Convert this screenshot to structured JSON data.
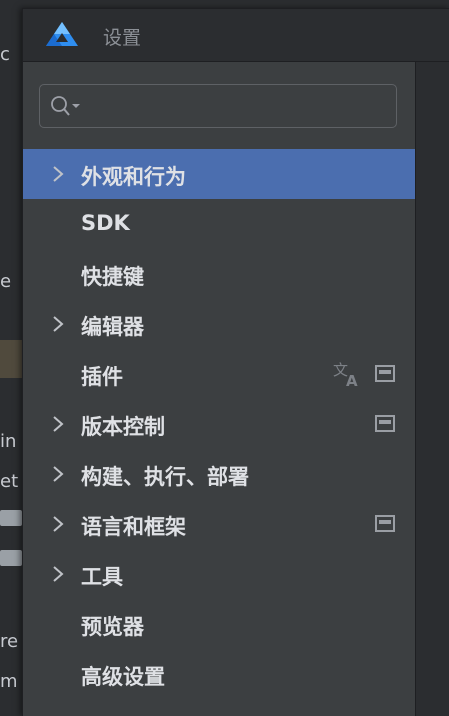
{
  "dialog": {
    "title": "设置",
    "search": {
      "placeholder": "",
      "value": ""
    }
  },
  "tree": [
    {
      "label": "外观和行为",
      "expandable": true,
      "selected": true
    },
    {
      "label": "SDK",
      "expandable": false
    },
    {
      "label": "快捷键",
      "expandable": false
    },
    {
      "label": "编辑器",
      "expandable": true
    },
    {
      "label": "插件",
      "expandable": false,
      "icons": [
        "translate-icon",
        "box-icon"
      ]
    },
    {
      "label": "版本控制",
      "expandable": true,
      "icons": [
        "box-icon"
      ]
    },
    {
      "label": "构建、执行、部署",
      "expandable": true
    },
    {
      "label": "语言和框架",
      "expandable": true,
      "icons": [
        "box-icon"
      ]
    },
    {
      "label": "工具",
      "expandable": true
    },
    {
      "label": "预览器",
      "expandable": false
    },
    {
      "label": "高级设置",
      "expandable": false
    }
  ],
  "colors": {
    "selection": "#4b6eaf",
    "panel": "#3c3f41",
    "titlebar": "#2b2d30",
    "text": "#dfe1e5"
  }
}
